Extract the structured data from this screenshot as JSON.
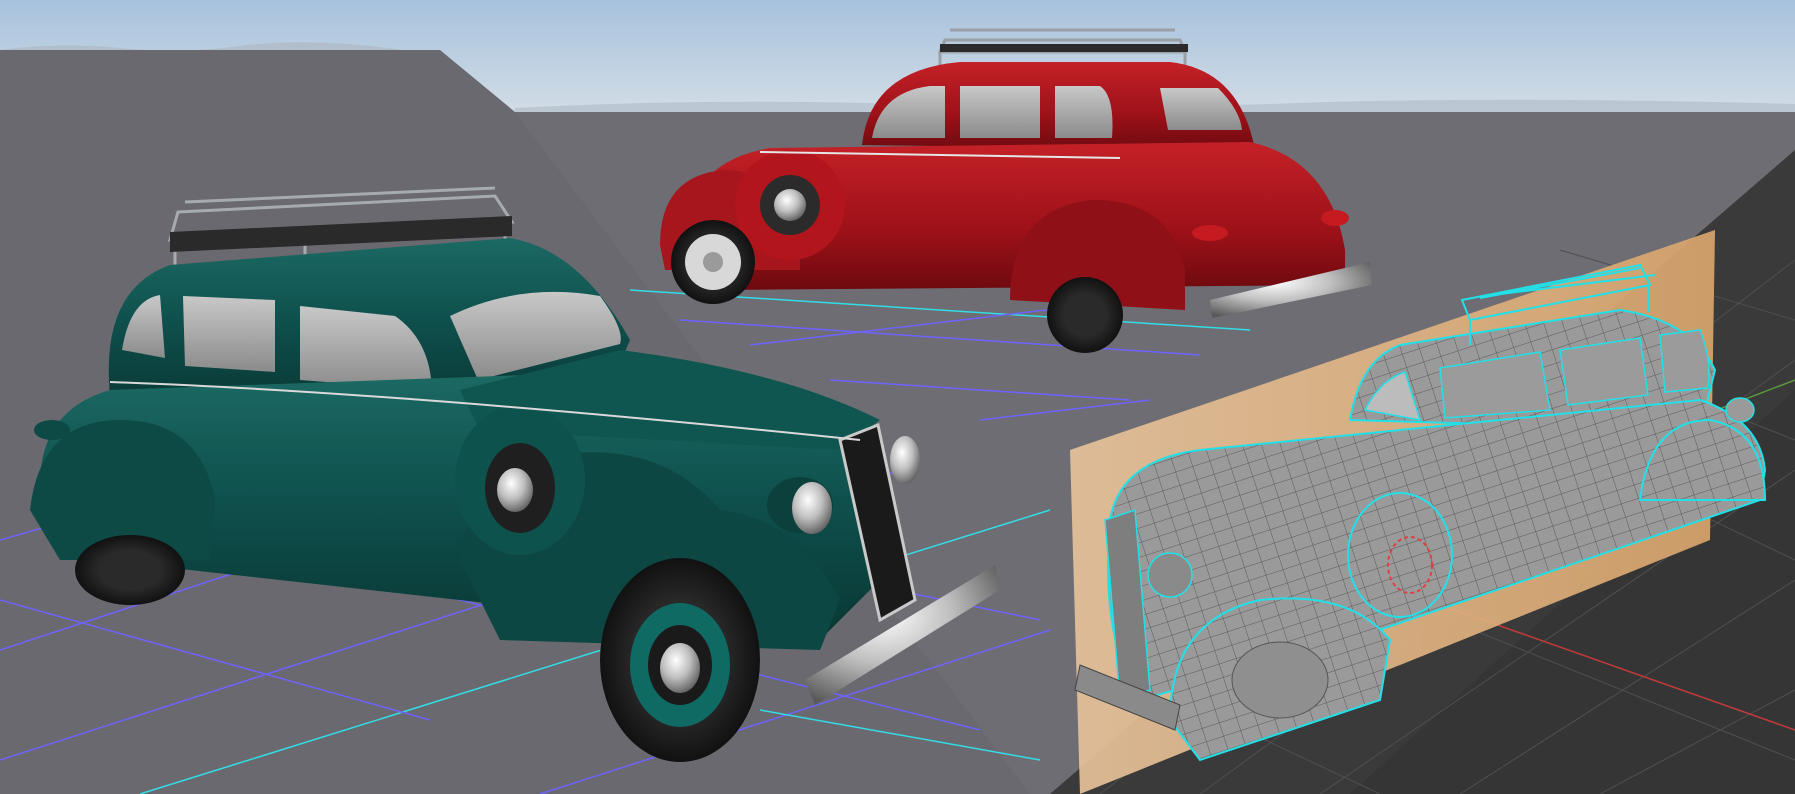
{
  "scene": {
    "type": "3d-render-composite",
    "subjects": [
      {
        "id": "green-sedan",
        "label": "",
        "body_color": "#0e4f4c",
        "wheel_accent": "#0f6a64",
        "roof_rack": true
      },
      {
        "id": "red-sedan",
        "label": "",
        "body_color": "#a5141b",
        "roof_rack": true
      },
      {
        "id": "wireframe-sedan",
        "label": "",
        "mesh_color": "#8e8e8e",
        "edge_highlight": "#22e0e8",
        "roof_rack": true
      }
    ],
    "colors": {
      "sky_top": "#aac4dd",
      "sky_bottom": "#c9d8e6",
      "ground": "#6b6b72",
      "grid_purple": "#6f63ff",
      "grid_cyan": "#33dde6",
      "viewport_bg": "#3a3a3a",
      "viewport_grid": "#505050",
      "axis_red": "#c33a3a",
      "axis_green": "#5a9a3a",
      "ref_plane": "#e7b987"
    }
  }
}
